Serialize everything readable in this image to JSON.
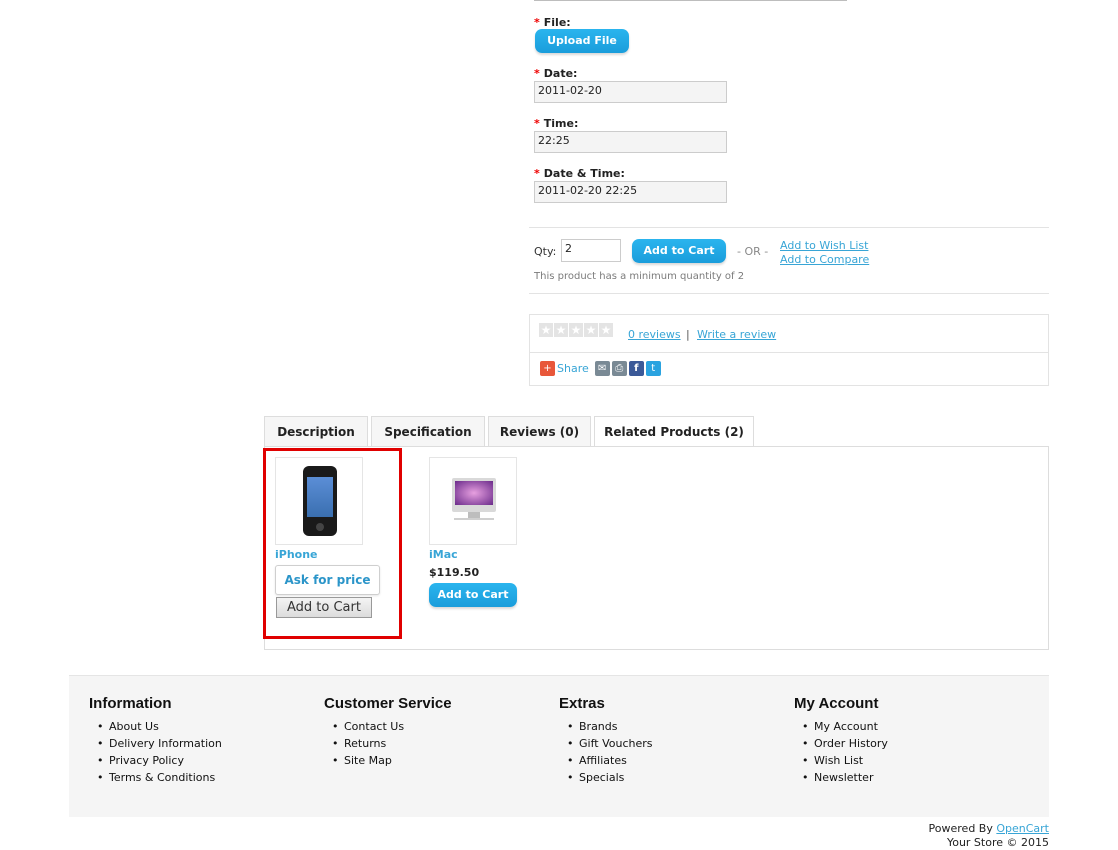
{
  "options": {
    "file": {
      "label": "File:",
      "button": "Upload File"
    },
    "date": {
      "label": "Date:",
      "value": "2011-02-20"
    },
    "time": {
      "label": "Time:",
      "value": "22:25"
    },
    "datetime": {
      "label": "Date & Time:",
      "value": "2011-02-20 22:25"
    },
    "required_mark": "*"
  },
  "cart": {
    "qty_label": "Qty:",
    "qty_value": "2",
    "add_button": "Add to Cart",
    "or_text": "- OR -",
    "wishlist_link": "Add to Wish List",
    "compare_link": "Add to Compare",
    "minimum_note": "This product has a minimum quantity of 2"
  },
  "review": {
    "stars": 0,
    "reviews_link": "0 reviews",
    "separator": "|",
    "write_link": "Write a review"
  },
  "share": {
    "label": "Share",
    "icons": [
      "share-plus-icon",
      "email-icon",
      "print-icon",
      "facebook-icon",
      "twitter-icon"
    ]
  },
  "tabs": [
    {
      "label": "Description"
    },
    {
      "label": "Specification"
    },
    {
      "label": "Reviews (0)"
    },
    {
      "label": "Related Products (2)"
    }
  ],
  "related": [
    {
      "name": "iPhone",
      "ask_button": "Ask for price",
      "cart_button": "Add to Cart",
      "image": "iphone-image"
    },
    {
      "name": "iMac",
      "price": "$119.50",
      "cart_button": "Add to Cart",
      "image": "imac-image"
    }
  ],
  "highlight_color": "#e00000",
  "footer": {
    "columns": [
      {
        "title": "Information",
        "items": [
          "About Us",
          "Delivery Information",
          "Privacy Policy",
          "Terms & Conditions"
        ]
      },
      {
        "title": "Customer Service",
        "items": [
          "Contact Us",
          "Returns",
          "Site Map"
        ]
      },
      {
        "title": "Extras",
        "items": [
          "Brands",
          "Gift Vouchers",
          "Affiliates",
          "Specials"
        ]
      },
      {
        "title": "My Account",
        "items": [
          "My Account",
          "Order History",
          "Wish List",
          "Newsletter"
        ]
      }
    ],
    "powered_by": "Powered By",
    "powered_link": "OpenCart",
    "copyright": "Your Store © 2015"
  }
}
